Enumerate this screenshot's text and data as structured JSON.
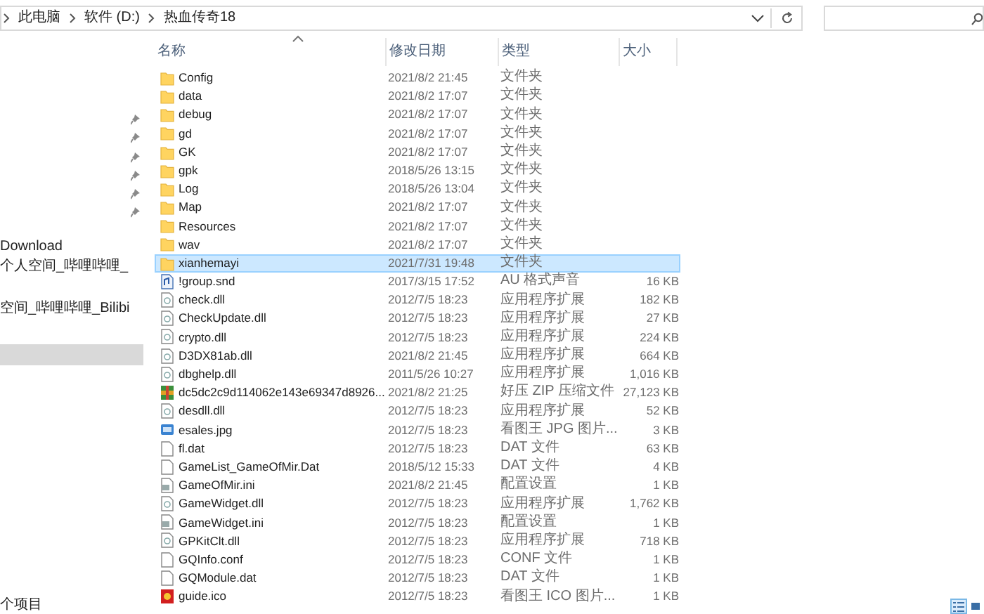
{
  "address_bar": {
    "breadcrumb": [
      "此电脑",
      "软件 (D:)",
      "热血传奇18"
    ]
  },
  "nav_pane": {
    "items": [
      {
        "pinned": true,
        "selected": false
      },
      {
        "pinned": true,
        "selected": false
      },
      {
        "pinned": true,
        "selected": false
      },
      {
        "pinned": true,
        "selected": false
      },
      {
        "pinned": true,
        "selected": false
      },
      {
        "pinned": true,
        "selected": false
      },
      {
        "label": "Download",
        "pinned": false,
        "selected": false
      },
      {
        "label": "个人空间_哔哩哔哩_",
        "pinned": false,
        "selected": false
      },
      {
        "label": "空间_哔哩哔哩_Bilibi",
        "pinned": false,
        "selected": false
      },
      {
        "pinned": false,
        "selected": true
      }
    ]
  },
  "columns": [
    {
      "label": "名称",
      "sort_ascending": true
    },
    {
      "label": "修改日期",
      "sort_ascending": false
    },
    {
      "label": "类型",
      "sort_ascending": false
    },
    {
      "label": "大小",
      "sort_ascending": false
    }
  ],
  "rows": [
    {
      "name": "Config",
      "modified": "2021/8/2 21:45",
      "type": "文件夹",
      "kind": "folder",
      "selected": false
    },
    {
      "name": "data",
      "modified": "2021/8/2 17:07",
      "type": "文件夹",
      "kind": "folder",
      "selected": false
    },
    {
      "name": "debug",
      "modified": "2021/8/2 17:07",
      "type": "文件夹",
      "kind": "folder",
      "selected": false
    },
    {
      "name": "gd",
      "modified": "2021/8/2 17:07",
      "type": "文件夹",
      "kind": "folder",
      "selected": false
    },
    {
      "name": "GK",
      "modified": "2021/8/2 17:07",
      "type": "文件夹",
      "kind": "folder",
      "selected": false
    },
    {
      "name": "gpk",
      "modified": "2018/5/26 13:15",
      "type": "文件夹",
      "kind": "folder",
      "selected": false
    },
    {
      "name": "Log",
      "modified": "2018/5/26 13:04",
      "type": "文件夹",
      "kind": "folder",
      "selected": false
    },
    {
      "name": "Map",
      "modified": "2021/8/2 17:07",
      "type": "文件夹",
      "kind": "folder",
      "selected": false
    },
    {
      "name": "Resources",
      "modified": "2021/8/2 17:07",
      "type": "文件夹",
      "kind": "folder",
      "selected": false
    },
    {
      "name": "wav",
      "modified": "2021/8/2 17:07",
      "type": "文件夹",
      "kind": "folder",
      "selected": false
    },
    {
      "name": "xianhemayi",
      "modified": "2021/7/31 19:48",
      "type": "文件夹",
      "kind": "folder",
      "selected": true
    },
    {
      "name": "!group.snd",
      "modified": "2017/3/15 17:52",
      "type": "AU 格式声音",
      "size": "16 KB",
      "kind": "audio",
      "selected": false
    },
    {
      "name": "check.dll",
      "modified": "2012/7/5 18:23",
      "type": "应用程序扩展",
      "size": "182 KB",
      "kind": "dll",
      "selected": false
    },
    {
      "name": "CheckUpdate.dll",
      "modified": "2012/7/5 18:23",
      "type": "应用程序扩展",
      "size": "27 KB",
      "kind": "dll",
      "selected": false
    },
    {
      "name": "crypto.dll",
      "modified": "2012/7/5 18:23",
      "type": "应用程序扩展",
      "size": "224 KB",
      "kind": "dll",
      "selected": false
    },
    {
      "name": "D3DX81ab.dll",
      "modified": "2021/8/2 21:45",
      "type": "应用程序扩展",
      "size": "664 KB",
      "kind": "dll",
      "selected": false
    },
    {
      "name": "dbghelp.dll",
      "modified": "2011/5/26 10:27",
      "type": "应用程序扩展",
      "size": "1,016 KB",
      "kind": "dll",
      "selected": false
    },
    {
      "name": "dc5dc2c9d114062e143e69347d8926...",
      "modified": "2021/8/2 21:25",
      "type": "好压 ZIP 压缩文件",
      "size": "27,123 KB",
      "kind": "archive",
      "selected": false
    },
    {
      "name": "desdll.dll",
      "modified": "2012/7/5 18:23",
      "type": "应用程序扩展",
      "size": "52 KB",
      "kind": "dll",
      "selected": false
    },
    {
      "name": "esales.jpg",
      "modified": "2012/7/5 18:23",
      "type": "看图王 JPG 图片...",
      "size": "3 KB",
      "kind": "image",
      "selected": false
    },
    {
      "name": "fl.dat",
      "modified": "2012/7/5 18:23",
      "type": "DAT 文件",
      "size": "63 KB",
      "kind": "file",
      "selected": false
    },
    {
      "name": "GameList_GameOfMir.Dat",
      "modified": "2018/5/12 15:33",
      "type": "DAT 文件",
      "size": "4 KB",
      "kind": "file",
      "selected": false
    },
    {
      "name": "GameOfMir.ini",
      "modified": "2021/8/2 21:45",
      "type": "配置设置",
      "size": "1 KB",
      "kind": "config",
      "selected": false
    },
    {
      "name": "GameWidget.dll",
      "modified": "2012/7/5 18:23",
      "type": "应用程序扩展",
      "size": "1,762 KB",
      "kind": "dll",
      "selected": false
    },
    {
      "name": "GameWidget.ini",
      "modified": "2012/7/5 18:23",
      "type": "配置设置",
      "size": "1 KB",
      "kind": "config",
      "selected": false
    },
    {
      "name": "GPKitClt.dll",
      "modified": "2012/7/5 18:23",
      "type": "应用程序扩展",
      "size": "718 KB",
      "kind": "dll",
      "selected": false
    },
    {
      "name": "GQInfo.conf",
      "modified": "2012/7/5 18:23",
      "type": "CONF 文件",
      "size": "1 KB",
      "kind": "file",
      "selected": false
    },
    {
      "name": "GQModule.dat",
      "modified": "2012/7/5 18:23",
      "type": "DAT 文件",
      "size": "1 KB",
      "kind": "file",
      "selected": false
    },
    {
      "name": "guide.ico",
      "modified": "2012/7/5 18:23",
      "type": "看图王 ICO 图片...",
      "size": "1 KB",
      "kind": "ico",
      "selected": false
    }
  ],
  "status_bar": {
    "text": "个项目",
    "views": [
      {
        "kind": "details",
        "selected": true
      },
      {
        "kind": "large_icons",
        "selected": false
      }
    ]
  }
}
